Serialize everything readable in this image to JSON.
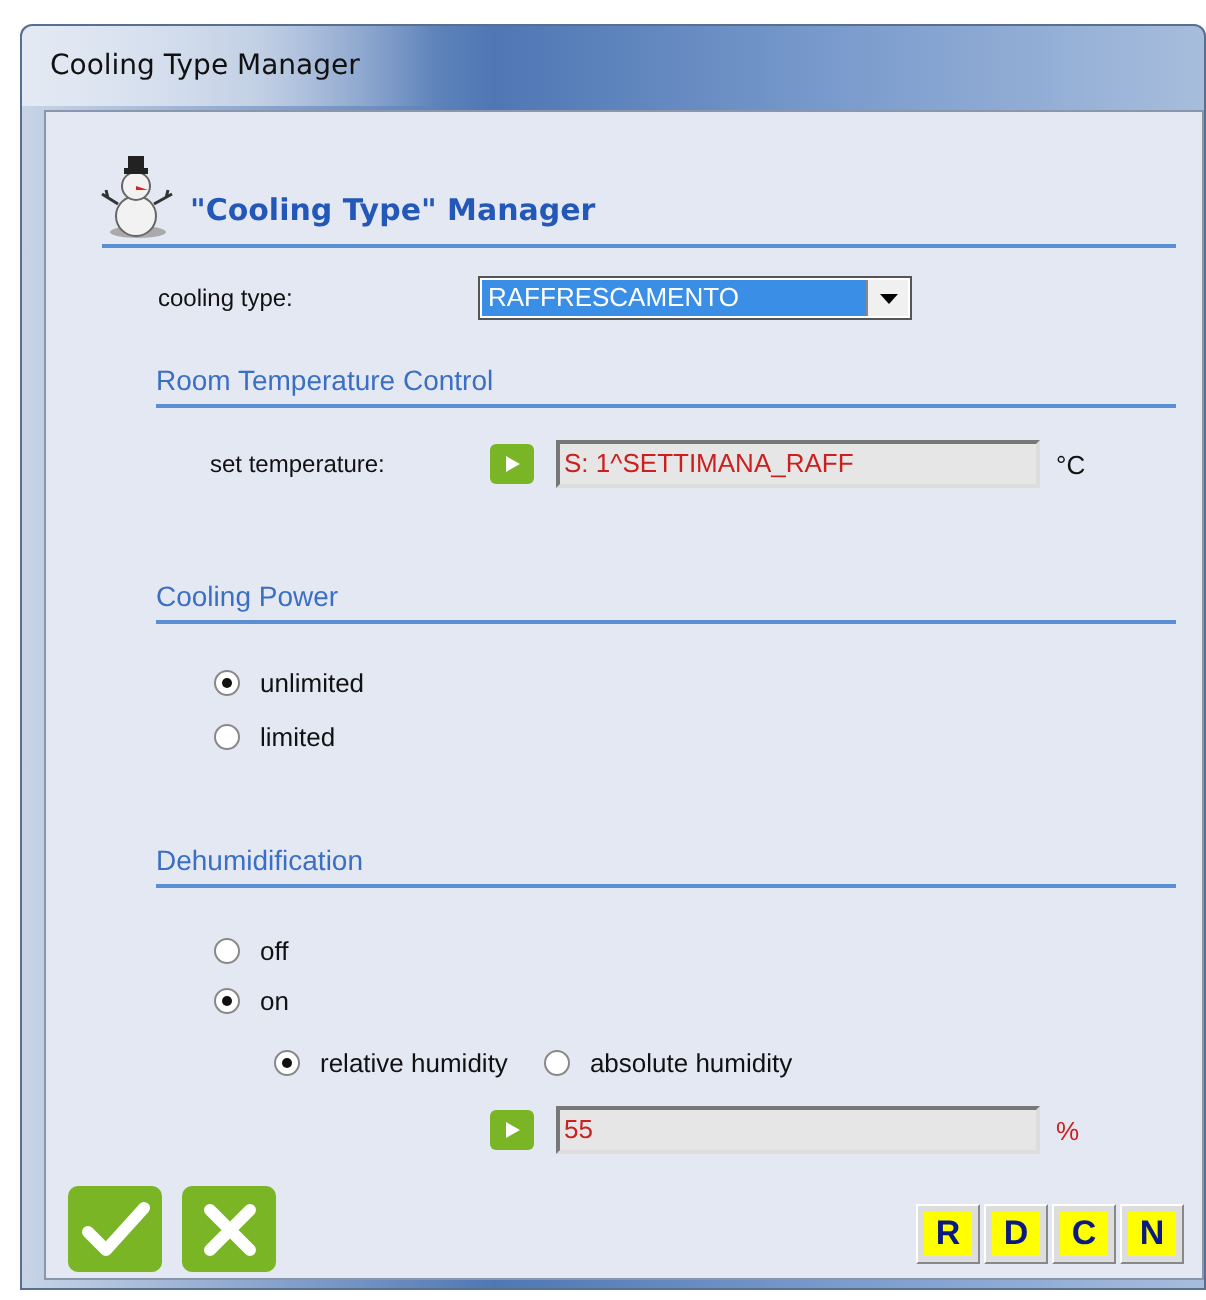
{
  "window": {
    "title": "Cooling Type Manager"
  },
  "header": {
    "title": "\"Cooling Type\" Manager"
  },
  "cooling_type": {
    "label": "cooling type:",
    "value": "RAFFRESCAMENTO"
  },
  "room_temperature": {
    "title": "Room Temperature Control",
    "label": "set temperature:",
    "value": "S: 1^SETTIMANA_RAFF",
    "unit": "°C"
  },
  "cooling_power": {
    "title": "Cooling Power",
    "options": [
      {
        "label": "unlimited",
        "selected": true
      },
      {
        "label": "limited",
        "selected": false
      }
    ]
  },
  "dehumidification": {
    "title": "Dehumidification",
    "options": [
      {
        "label": "off",
        "selected": false
      },
      {
        "label": "on",
        "selected": true
      }
    ],
    "humidity_types": [
      {
        "label": "relative humidity",
        "selected": true
      },
      {
        "label": "absolute humidity",
        "selected": false
      }
    ],
    "value": "55",
    "unit": "%"
  },
  "buttons": [
    {
      "kind": "ok"
    },
    {
      "kind": "cancel"
    }
  ],
  "letter_buttons": [
    "R",
    "D",
    "C",
    "N"
  ]
}
